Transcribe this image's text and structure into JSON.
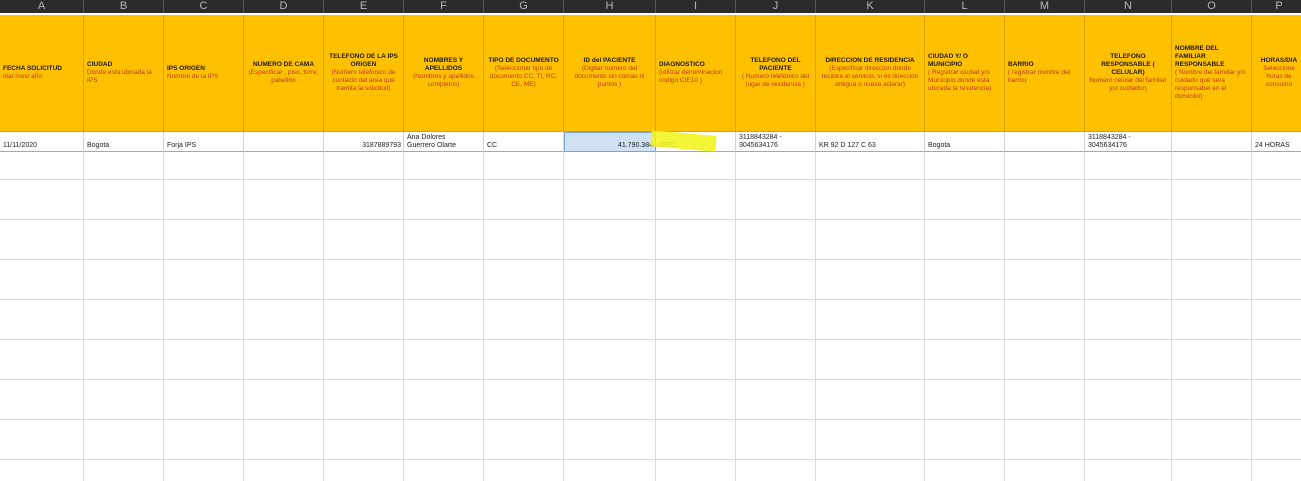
{
  "columns": [
    "A",
    "B",
    "C",
    "D",
    "E",
    "F",
    "G",
    "H",
    "I",
    "J",
    "K",
    "L",
    "M",
    "N",
    "O",
    "P"
  ],
  "headers": [
    {
      "title": "FECHA SOLICITUD",
      "sub": "dia/ mes/ año"
    },
    {
      "title": "CIUDAD",
      "sub": "Donde esta ubicada la IPS"
    },
    {
      "title": "IPS ORIGEN",
      "sub": "Nombre de la IPS"
    },
    {
      "title": "NUMERO DE CAMA",
      "sub": "(Especificar , piso, torre, pabellón"
    },
    {
      "title": "TELEFONO DE LA IPS ORIGEN",
      "sub": "(Numero telefonico de contacto del area que tramita la solicitud)"
    },
    {
      "title": "NOMBRES Y APELLIDOS",
      "sub": "(Nombres y apellidos completos)"
    },
    {
      "title": "TIPO DE DOCUMENTO",
      "sub": "(Seleccionar tipo de documento CC, TI, RC, CE, ME)"
    },
    {
      "title": "ID del PACIENTE",
      "sub": "(Digitar numero del documento sin comas ni puntos )"
    },
    {
      "title": "DIAGNOSTICO",
      "sub": "(utilizar denominacion codigo CIE10 )"
    },
    {
      "title": "TELEFONO DEL PACIENTE",
      "sub": "( Numero telefonico del lugar de residencia )"
    },
    {
      "title": "DIRECCION DE RESIDENCIA",
      "sub": "(Especificar direccion donde recibira el servicio, si es direccion antigua o nueva aclarar)"
    },
    {
      "title": "CIUDAD Y/ O MUNICIPIO",
      "sub": "( Regsitrar ciudad y/o Municipio donde esta ubicada la residencia)"
    },
    {
      "title": "BARRIO",
      "sub": "( registrar nombre del barrio)"
    },
    {
      "title": "TELEFONO RESPONSABLE ( CELULAR)",
      "sub": "Numero celular del familiar y/o cuidador)"
    },
    {
      "title": "NOMBRE DEL FAMILIAR RESPONSABLE",
      "sub": "( Nombre del familiar y/o cuidado que sera responsabel en el domicilio)"
    },
    {
      "title": "HORAS/DIA",
      "sub": "Seleccione horas de consumo"
    }
  ],
  "row": [
    "11/11/2020",
    "Bogota",
    "Forja IPS",
    "",
    "3187889793",
    "Ana Dolores\nGuerrero Olarte",
    "CC",
    "41.790.384",
    "U071",
    "3118843284 -\n3045634176",
    "KR 92 D 127 C 63",
    "Bogota",
    "",
    "3118843284 -\n3045634176",
    "",
    "24 HORAS"
  ]
}
